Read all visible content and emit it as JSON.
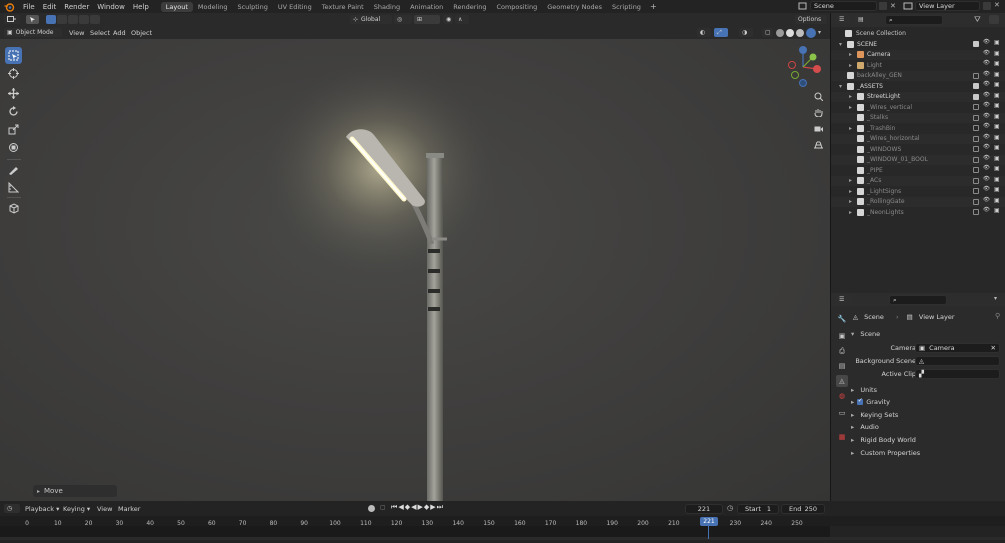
{
  "menu": {
    "items": [
      "File",
      "Edit",
      "Render",
      "Window",
      "Help"
    ]
  },
  "workspaces": {
    "tabs": [
      "Layout",
      "Modeling",
      "Sculpting",
      "UV Editing",
      "Texture Paint",
      "Shading",
      "Animation",
      "Rendering",
      "Compositing",
      "Geometry Nodes",
      "Scripting"
    ],
    "active": "Layout"
  },
  "scene_selector": {
    "value": "Scene"
  },
  "view_layer_selector": {
    "value": "View Layer"
  },
  "viewport_header": {
    "transform_orientation": "Global",
    "options_label": "Options",
    "mode": "Object Mode",
    "menus": [
      "View",
      "Select",
      "Add",
      "Object"
    ]
  },
  "viewport": {
    "last_operator": "Move"
  },
  "outliner": {
    "root_label": "Scene Collection",
    "rows": [
      {
        "label": "SCENE",
        "indent": 1,
        "type": "collection",
        "checked": true,
        "expandable": true,
        "expanded": true
      },
      {
        "label": "Camera",
        "indent": 2,
        "type": "camera",
        "checked": null,
        "expandable": true,
        "expanded": false
      },
      {
        "label": "Light",
        "indent": 2,
        "type": "light",
        "checked": null,
        "expandable": true,
        "expanded": false,
        "muted": true
      },
      {
        "label": "backAlley_GEN",
        "indent": 1,
        "type": "collection",
        "checked": false,
        "expandable": false,
        "muted": true
      },
      {
        "label": "_ASSETS",
        "indent": 1,
        "type": "collection",
        "checked": true,
        "expandable": true,
        "expanded": true
      },
      {
        "label": "StreetLight",
        "indent": 2,
        "type": "collection",
        "checked": true,
        "expandable": true,
        "expanded": false
      },
      {
        "label": "_Wires_vertical",
        "indent": 2,
        "type": "collection",
        "checked": false,
        "expandable": true,
        "muted": true
      },
      {
        "label": "_Stalks",
        "indent": 2,
        "type": "collection",
        "checked": false,
        "expandable": false,
        "muted": true
      },
      {
        "label": "_TrashBin",
        "indent": 2,
        "type": "collection",
        "checked": false,
        "expandable": true,
        "muted": true
      },
      {
        "label": "_Wires_horizontal",
        "indent": 2,
        "type": "collection",
        "checked": false,
        "expandable": false,
        "muted": true
      },
      {
        "label": "_WINDOWS",
        "indent": 2,
        "type": "collection",
        "checked": false,
        "expandable": false,
        "muted": true
      },
      {
        "label": "_WINDOW_01_BOOL",
        "indent": 2,
        "type": "collection",
        "checked": false,
        "expandable": false,
        "muted": true
      },
      {
        "label": "_PIPE",
        "indent": 2,
        "type": "collection",
        "checked": false,
        "expandable": false,
        "muted": true
      },
      {
        "label": "_ACs",
        "indent": 2,
        "type": "collection",
        "checked": false,
        "expandable": true,
        "muted": true
      },
      {
        "label": "_LightSigns",
        "indent": 2,
        "type": "collection",
        "checked": false,
        "expandable": true,
        "muted": true
      },
      {
        "label": "_RollingGate",
        "indent": 2,
        "type": "collection",
        "checked": false,
        "expandable": true,
        "muted": true
      },
      {
        "label": "_NeonLights",
        "indent": 2,
        "type": "collection",
        "checked": false,
        "expandable": true,
        "muted": true
      }
    ]
  },
  "properties": {
    "breadcrumb": {
      "scene": "Scene",
      "view_layer": "View Layer"
    },
    "section_scene": "Scene",
    "fields": [
      {
        "label": "Camera",
        "value": "Camera"
      },
      {
        "label": "Background Scene",
        "value": ""
      },
      {
        "label": "Active Clip",
        "value": ""
      }
    ],
    "panels": [
      "Units",
      "Gravity",
      "Keying Sets",
      "Audio",
      "Rigid Body World",
      "Custom Properties"
    ],
    "gravity_checked": true
  },
  "timeline": {
    "menus": [
      "Playback",
      "Keying",
      "View",
      "Marker"
    ],
    "current_frame": "221",
    "start_label": "Start",
    "start": "1",
    "end_label": "End",
    "end": "250",
    "ticks": [
      "0",
      "10",
      "20",
      "30",
      "40",
      "50",
      "60",
      "70",
      "80",
      "90",
      "100",
      "110",
      "120",
      "130",
      "140",
      "150",
      "160",
      "170",
      "180",
      "190",
      "200",
      "210",
      "230",
      "240",
      "250"
    ]
  },
  "colors": {
    "accent": "#4772b3",
    "playhead": "#4772b3",
    "lamp_glow": "#fff1a8"
  }
}
